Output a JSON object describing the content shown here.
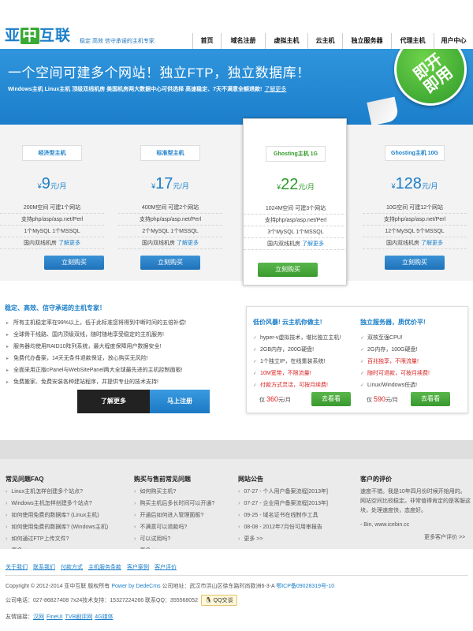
{
  "header": {
    "logo": {
      "pre": "亚",
      "mid": "中",
      "post": "互联"
    },
    "slogan": "稳定  高效  信守承诺的主机专家",
    "nav": [
      "首页",
      "域名注册",
      "虚拟主机",
      "云主机",
      "独立服务器",
      "代理主机",
      "用户中心"
    ]
  },
  "banner": {
    "title": "一个空间可建多个网站！独立FTP，独立数据库！",
    "subtitle": "Windows主机 Linux主机 顶级双线机房 美国机房两大数据中心可供选择 高速稳定、7天不满意全额退款!",
    "more": "了解更多",
    "badge": "即开即用"
  },
  "plans": [
    {
      "name": "经济型主机",
      "currency": "¥",
      "price": "9",
      "unit": "元/月",
      "lines": [
        "200M空间 可建1个网站",
        "支持php/asp/asp.net/Perl",
        "1个MySQL 1个MSSQL"
      ],
      "room": "国内双线机房",
      "more": "了解更多",
      "button": "立刻购买"
    },
    {
      "name": "标准型主机",
      "currency": "¥",
      "price": "17",
      "unit": "元/月",
      "lines": [
        "400M空间 可建2个网站",
        "支持php/asp/asp.net/Perl",
        "2个MySQL 1个MSSQL"
      ],
      "room": "国内双线机房",
      "more": "了解更多",
      "button": "立刻购买"
    },
    {
      "name": "Ghosting主机 1G",
      "currency": "¥",
      "price": "22",
      "unit": "元/月",
      "lines": [
        "1024M空间 可建3个网站",
        "支持php/asp/asp.net/Perl",
        "3个MySQL 1个MSSQL"
      ],
      "room": "国内双线机房",
      "more": "了解更多",
      "button": "立刻购买"
    },
    {
      "name": "Ghosting主机 10G",
      "currency": "¥",
      "price": "128",
      "unit": "元/月",
      "lines": [
        "10G空间 可建12个网站",
        "支持php/asp/asp.net/Perl",
        "12个MySQL 5个MSSQL"
      ],
      "room": "国内双线机房",
      "more": "了解更多",
      "button": "立刻购买"
    }
  ],
  "features": {
    "title": "稳定、高效、信守承诺的主机专家！",
    "items": [
      "所有主机稳定率在99%以上，低于此标准您将得到中断时间的五倍补偿!",
      "全球骨干线路、国内顶级双线，随时随地享受稳定的主机服务!",
      "服务器均使用RAID10阵列系统，最大程度保障用户数据安全!",
      "免费代办备案，14天无条件退款保证，放心购买无风险!",
      "全面采用正版cPanel与WebSitePanel两大全球最先进的主机控制面板!",
      "免费搬家、免费安装各种建站程序，并提供专业的技术支持!"
    ],
    "btn_more": "了解更多",
    "btn_register": "马上注册"
  },
  "promo": {
    "cloud": {
      "title": "低价风暴! 云主机你做主!",
      "items": [
        "hyper-v虚拟技术，堪比独立主机!",
        "2GB内存，200G硬盘!",
        "1个独立IP，在线重装系统!",
        "10M宽带，不限流量!",
        "付款方式灵活，可按月续费!"
      ],
      "price_pre": "仅",
      "price": "360",
      "price_post": "元/月",
      "button": "去看看"
    },
    "server": {
      "title": "独立服务器，质优价平!",
      "items": [
        "双核至强CPU!",
        "2G内存，100G硬盘!",
        "百兆独享，不限流量!",
        "随时可退款，可按月续费!",
        "Linux/Windows任选!"
      ],
      "price_pre": "仅",
      "price": "590",
      "price_post": "元/月",
      "button": "去看看"
    }
  },
  "lower": {
    "faq": {
      "title": "常见问题FAQ",
      "items": [
        "Linux主机怎样创建多个站点?",
        "Windows主机怎样创建多个站点?",
        "如何使用免费的数据库? (Linux主机)",
        "如何使用免费的数据库? (Windows主机)",
        "如何通过FTP上传文件?",
        "更多 >>"
      ]
    },
    "presale": {
      "title": "购买与售前常见问题",
      "items": [
        "如何购买主机?",
        "购买主机后多长时间可以开通?",
        "开通后如何进入管理面板?",
        "不满意可以退款吗?",
        "可以试用吗?",
        "更多 >>"
      ]
    },
    "news": {
      "title": "网站公告",
      "items": [
        "07-27 - 个人用户备案流程[2013年]",
        "07-27 - 企业用户备案流程[2013年]",
        "09-25 - 域名证书在线制作工具",
        "08-08 - 2012年7月份可用审报告",
        "更多 >>"
      ]
    },
    "review": {
      "title": "客户的评价",
      "text": "速度不错。我是10年四月份时候开始用的。网站空间比较稳定。非常值得肯定的是客服这块，处理速度快，态度好。",
      "source": "- Bin, www.icebin.cc",
      "more": "更多客户评价 >>"
    }
  },
  "footer": {
    "links": [
      "关于我们",
      "联系我们",
      "付款方式",
      "主机服务条款",
      "客户案例",
      "客户评价"
    ],
    "copyright": "Copyright © 2012-2014 亚中互联 版权所有",
    "powered": "Power by DedeCms",
    "address": "公司地址：武汉市洪山区徐东路时尚欧洲6-3-A",
    "icp": "鄂ICP备09028319号-10",
    "contact": "公司电话：027-86827408 7x24技术支持：15327224266 联系QQ：355568052",
    "qq": "QQ交谈",
    "friend_label": "友情链接：",
    "friend_links": [
      "汉网",
      "FineUI",
      "TVB剧评网",
      "4G媒体"
    ]
  }
}
